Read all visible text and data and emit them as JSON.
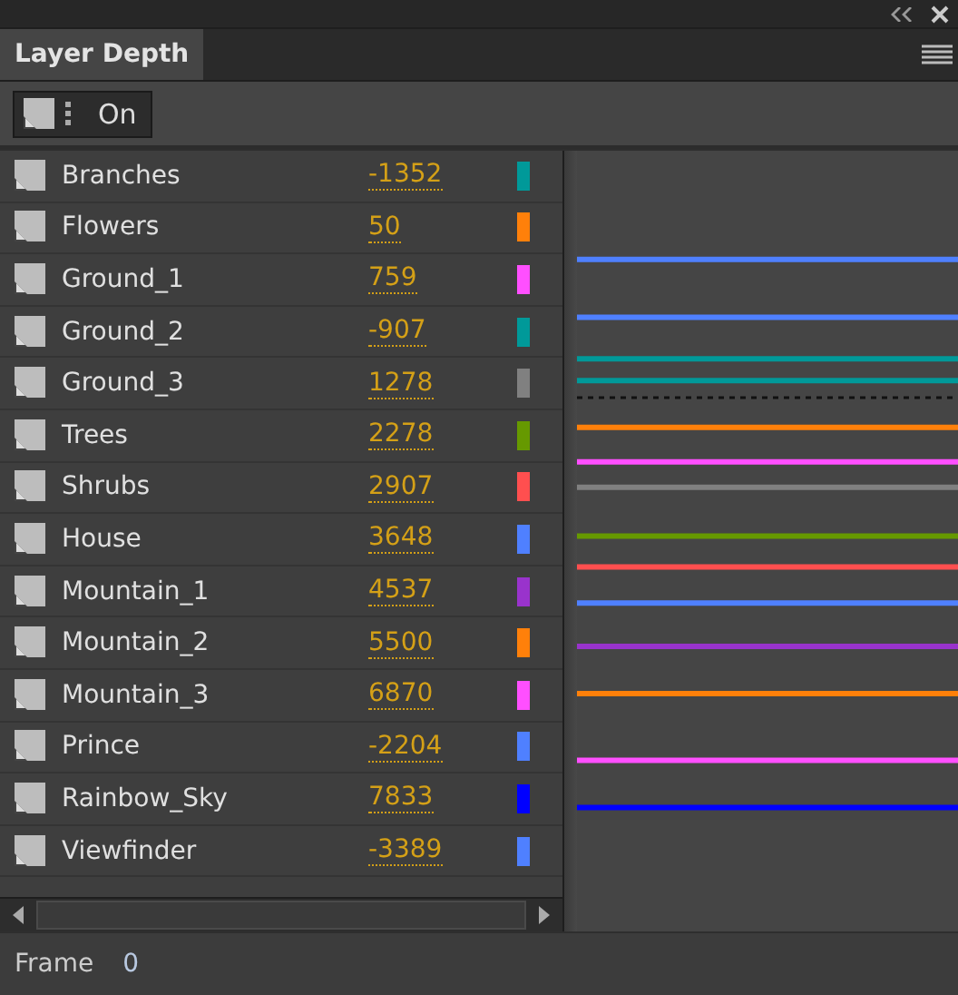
{
  "panel": {
    "title": "Layer Depth",
    "selected": true
  },
  "toolbar": {
    "toggle": "On"
  },
  "layers": [
    {
      "name": "Branches",
      "depth": "-1352",
      "color": "#009999"
    },
    {
      "name": "Flowers",
      "depth": "50",
      "color": "#ff800a"
    },
    {
      "name": "Ground_1",
      "depth": "759",
      "color": "#ff4fff"
    },
    {
      "name": "Ground_2",
      "depth": "-907",
      "color": "#009999"
    },
    {
      "name": "Ground_3",
      "depth": "1278",
      "color": "#808080"
    },
    {
      "name": "Trees",
      "depth": "2278",
      "color": "#669900"
    },
    {
      "name": "Shrubs",
      "depth": "2907",
      "color": "#ff4f4f"
    },
    {
      "name": "House",
      "depth": "3648",
      "color": "#4f80ff"
    },
    {
      "name": "Mountain_1",
      "depth": "4537",
      "color": "#9933cc"
    },
    {
      "name": "Mountain_2",
      "depth": "5500",
      "color": "#ff800a"
    },
    {
      "name": "Mountain_3",
      "depth": "6870",
      "color": "#ff4fff"
    },
    {
      "name": "Prince",
      "depth": "-2204",
      "color": "#4f80ff"
    },
    {
      "name": "Rainbow_Sky",
      "depth": "7833",
      "color": "#0000ff"
    },
    {
      "name": "Viewfinder",
      "depth": "-3389",
      "color": "#4f80ff"
    }
  ],
  "status_bar": {
    "label": "Frame",
    "value": "0"
  }
}
